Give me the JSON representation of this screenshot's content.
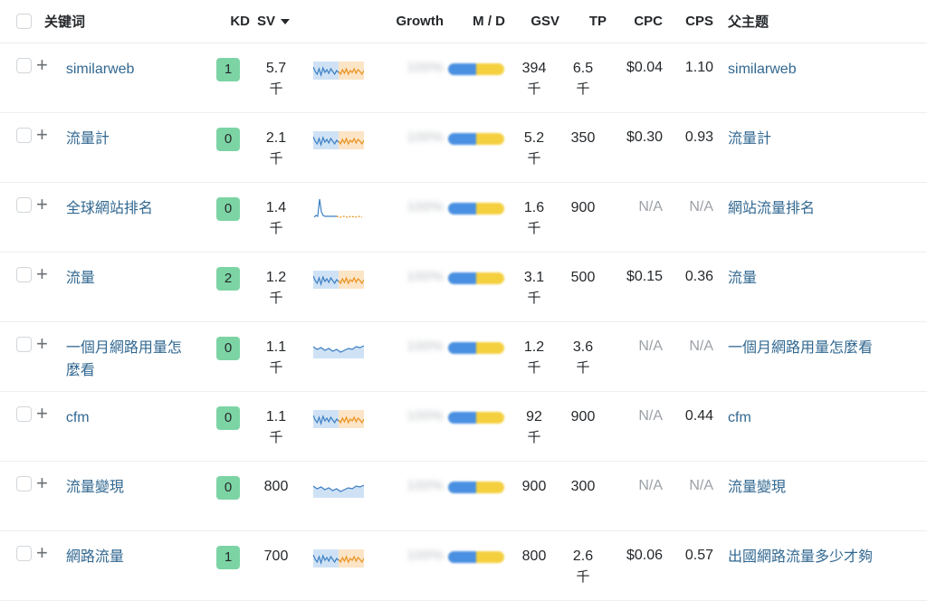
{
  "table": {
    "select_all_checkbox": "select-all",
    "columns": [
      {
        "key": "keyword",
        "label": "关键词",
        "align": "left"
      },
      {
        "key": "kd",
        "label": "KD",
        "align": "right"
      },
      {
        "key": "sv",
        "label": "SV",
        "align": "left",
        "sorted": "desc"
      },
      {
        "key": "trend",
        "label": "",
        "align": "center"
      },
      {
        "key": "growth",
        "label": "Growth",
        "align": "right"
      },
      {
        "key": "md",
        "label": "M / D",
        "align": "center"
      },
      {
        "key": "gsv",
        "label": "GSV",
        "align": "right"
      },
      {
        "key": "tp",
        "label": "TP",
        "align": "right"
      },
      {
        "key": "cpc",
        "label": "CPC",
        "align": "right"
      },
      {
        "key": "cps",
        "label": "CPS",
        "align": "right"
      },
      {
        "key": "parent",
        "label": "父主题",
        "align": "left"
      }
    ],
    "sort_caret_icon": "caret-down-icon",
    "add_icon": "plus-icon",
    "unit_thousand": "千",
    "na_label": "N/A",
    "growth_obscured": "100%",
    "rows": [
      {
        "keyword": "similarweb",
        "kd": "1",
        "sv": "5.7",
        "sv_unit": "千",
        "growth": "100%",
        "gsv": "394",
        "gsv_unit": "千",
        "tp": "6.5",
        "tp_unit": "千",
        "cpc": "$0.04",
        "cps": "1.10",
        "parent": "similarweb",
        "trend": "blue-orange-split"
      },
      {
        "keyword": "流量計",
        "kd": "0",
        "sv": "2.1",
        "sv_unit": "千",
        "growth": "100%",
        "gsv": "5.2",
        "gsv_unit": "千",
        "tp": "350",
        "tp_unit": "",
        "cpc": "$0.30",
        "cps": "0.93",
        "parent": "流量計",
        "trend": "blue-orange-split"
      },
      {
        "keyword": "全球網站排名",
        "kd": "0",
        "sv": "1.4",
        "sv_unit": "千",
        "growth": "100%",
        "gsv": "1.6",
        "gsv_unit": "千",
        "tp": "900",
        "tp_unit": "",
        "cpc": "N/A",
        "cps": "N/A",
        "parent": "網站流量排名",
        "trend": "spike"
      },
      {
        "keyword": "流量",
        "kd": "2",
        "sv": "1.2",
        "sv_unit": "千",
        "growth": "100%",
        "gsv": "3.1",
        "gsv_unit": "千",
        "tp": "500",
        "tp_unit": "",
        "cpc": "$0.15",
        "cps": "0.36",
        "parent": "流量",
        "trend": "blue-orange-split"
      },
      {
        "keyword": "一個月網路用量怎麼看",
        "kd": "0",
        "sv": "1.1",
        "sv_unit": "千",
        "growth": "100%",
        "gsv": "1.2",
        "gsv_unit": "千",
        "tp": "3.6",
        "tp_unit": "千",
        "cpc": "N/A",
        "cps": "N/A",
        "parent": "一個月網路用量怎麼看",
        "trend": "blue-only"
      },
      {
        "keyword": "cfm",
        "kd": "0",
        "sv": "1.1",
        "sv_unit": "千",
        "growth": "100%",
        "gsv": "92",
        "gsv_unit": "千",
        "tp": "900",
        "tp_unit": "",
        "cpc": "N/A",
        "cps": "0.44",
        "parent": "cfm",
        "trend": "blue-orange-split"
      },
      {
        "keyword": "流量變現",
        "kd": "0",
        "sv": "800",
        "sv_unit": "",
        "growth": "100%",
        "gsv": "900",
        "gsv_unit": "",
        "tp": "300",
        "tp_unit": "",
        "cpc": "N/A",
        "cps": "N/A",
        "parent": "流量變現",
        "trend": "blue-only"
      },
      {
        "keyword": "網路流量",
        "kd": "1",
        "sv": "700",
        "sv_unit": "",
        "growth": "100%",
        "gsv": "800",
        "gsv_unit": "",
        "tp": "2.6",
        "tp_unit": "千",
        "cpc": "$0.06",
        "cps": "0.57",
        "parent": "出國網路流量多少才夠",
        "trend": "blue-orange-split"
      }
    ]
  },
  "colors": {
    "kd_badge_bg": "#7cd4a4",
    "link": "#326891",
    "text": "#25282b",
    "muted": "#9ca1a6",
    "border": "#eceef0",
    "spark_blue": "#3b7fc4",
    "spark_blue_fill": "#cfe2f5",
    "spark_orange": "#e8921f",
    "spark_orange_fill": "#fce4c6",
    "md_blue": "#4a90e2",
    "md_yellow": "#f4d03f"
  }
}
